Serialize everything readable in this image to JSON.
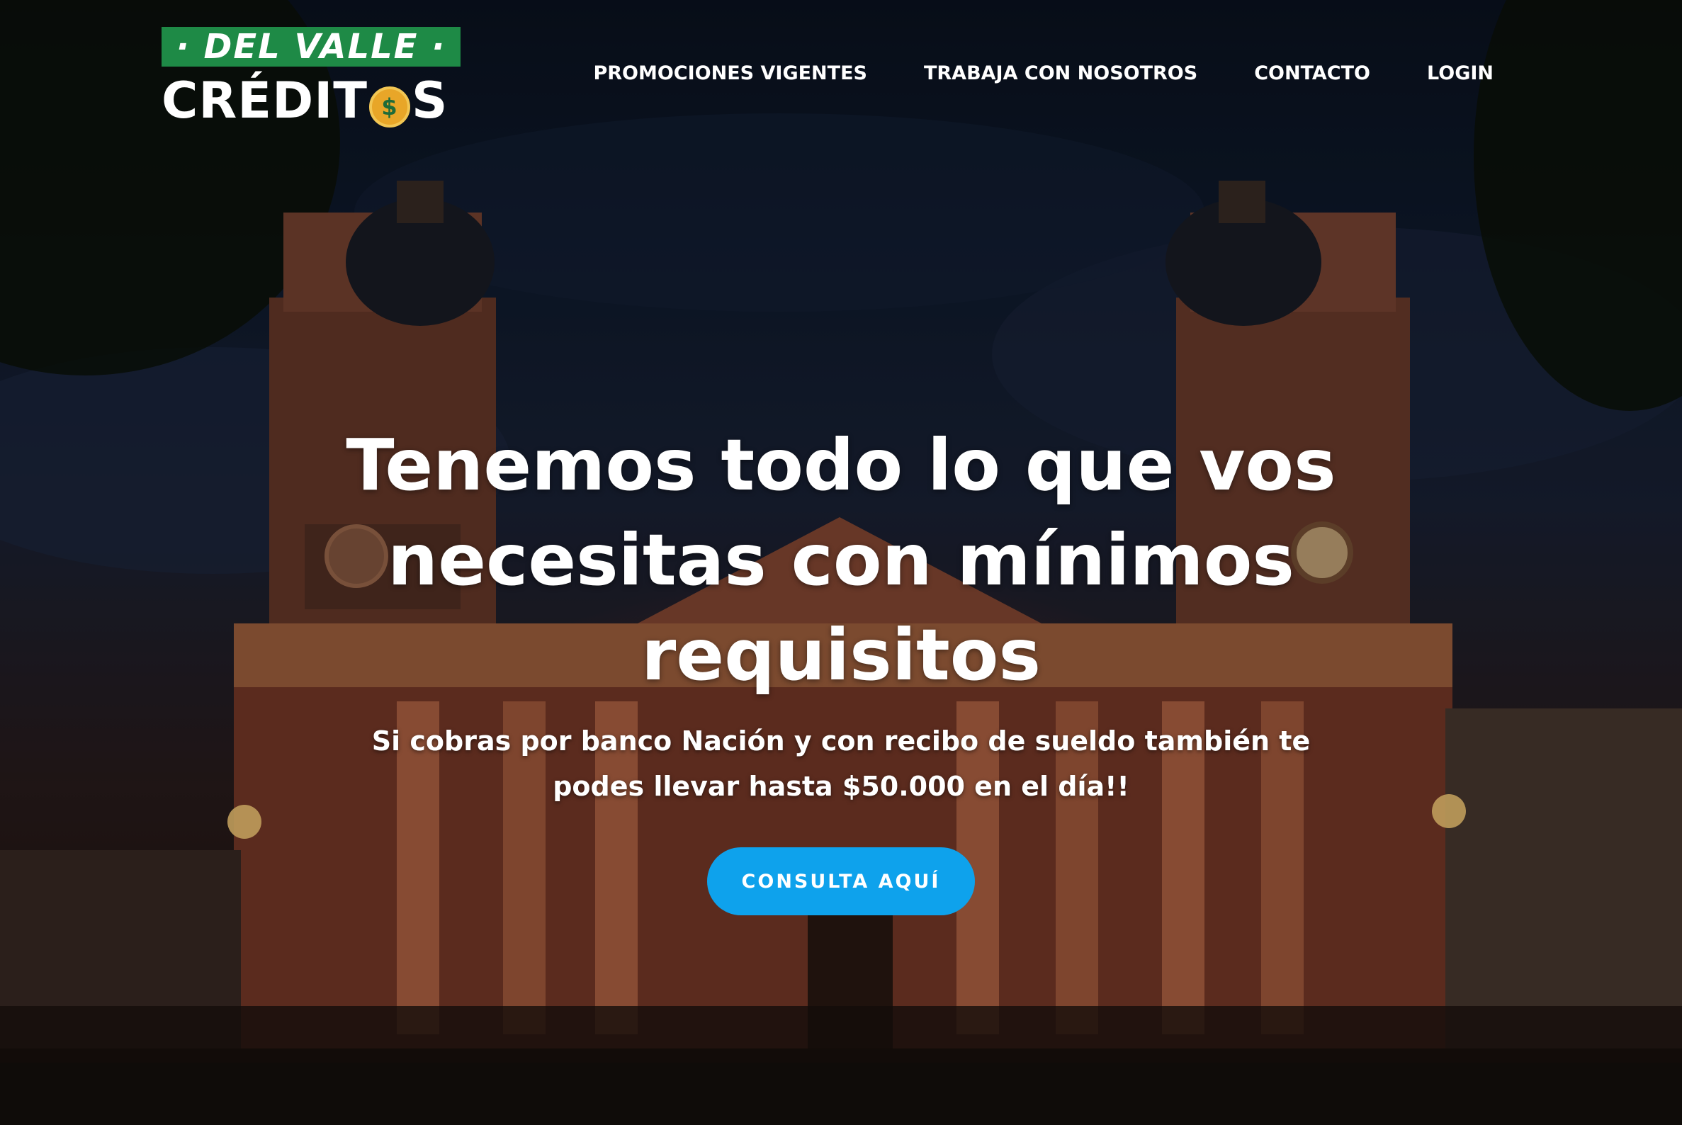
{
  "header": {
    "logo": {
      "line1": "· DEL VALLE ·",
      "line2_left": "CRÉDIT",
      "coin_symbol": "$",
      "line2_right": "S"
    },
    "nav": [
      {
        "label": "PROMOCIONES VIGENTES"
      },
      {
        "label": "TRABAJA CON NOSOTROS"
      },
      {
        "label": "CONTACTO"
      },
      {
        "label": "LOGIN"
      }
    ]
  },
  "hero": {
    "headline": "Tenemos todo lo que vos necesitas con mínimos requisitos",
    "subheadline": "Si cobras por banco Nación y con recibo de sueldo también te podes llevar hasta $50.000 en el día!!",
    "cta_label": "CONSULTA AQUÍ"
  },
  "colors": {
    "logo_green": "#1e8a46",
    "coin_gold": "#e8a628",
    "cta_blue": "#0ea2ec",
    "text": "#ffffff"
  }
}
